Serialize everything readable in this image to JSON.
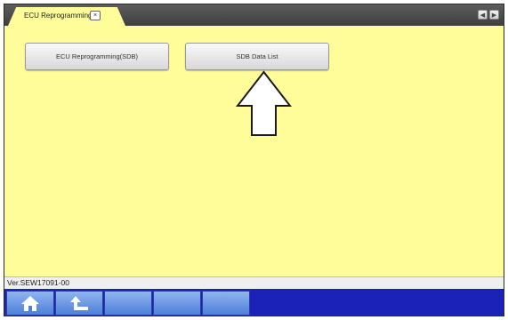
{
  "tabs": [
    {
      "label": "ECU Reprogramming",
      "close_glyph": "×"
    }
  ],
  "tabbar": {
    "scroll_left": "◀",
    "scroll_right": "▶"
  },
  "buttons": {
    "ecu_reprogramming": "ECU Reprogramming(SDB)",
    "sdb_data_list": "SDB Data List"
  },
  "status": {
    "version": "Ver.SEW17091-00"
  },
  "nav": {
    "icons": [
      "home-icon",
      "back-up-icon"
    ]
  },
  "colors": {
    "content_bg": "#fefd9a",
    "tabbar_bg": "#4a4a4a",
    "nav_bg": "#1a22b8",
    "nav_button": "#6f9ae6"
  }
}
